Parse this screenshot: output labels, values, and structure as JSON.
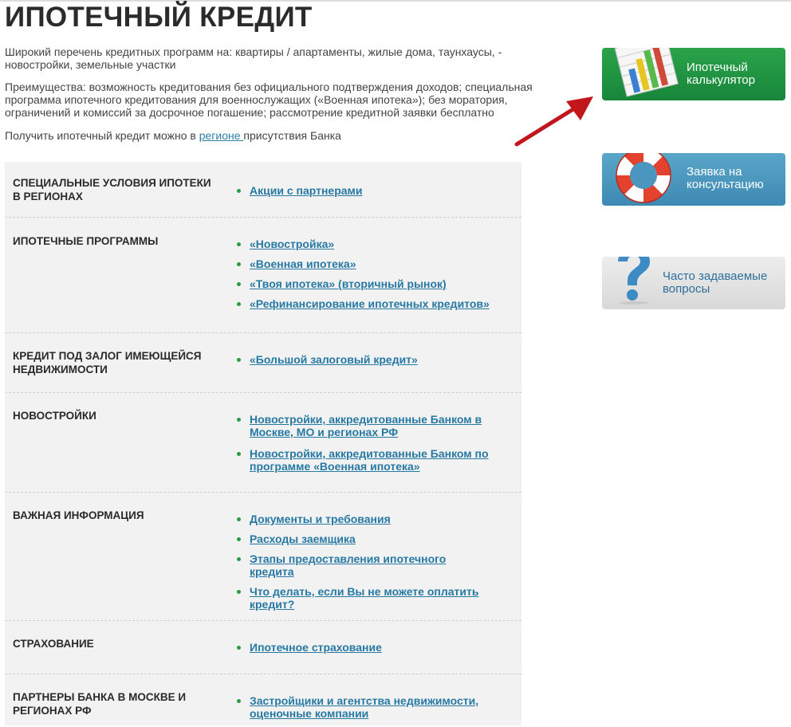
{
  "page": {
    "title": "ИПОТЕЧНЫЙ КРЕДИТ",
    "intro_1": "Широкий перечень кредитных программ на: квартиры / апартаменты, жилые дома,  таунхаусы, - новостройки,  земельные участки",
    "intro_2": "Преимущества: возможность кредитования без официального подтверждения доходов; специальная программа ипотечного кредитования для военнослужащих («Военная ипотека»); без моратория, ограничений и комиссий за досрочное погашение; рассмотрение кредитной заявки бесплатно",
    "intro_3_before": "Получить ипотечный кредит можно в ",
    "intro_3_link": "регионе ",
    "intro_3_after": "присутствия Банка"
  },
  "sections": [
    {
      "title": "СПЕЦИАЛЬНЫЕ УСЛОВИЯ ИПОТЕКИ В РЕГИОНАХ",
      "links": [
        "Акции с партнерами"
      ]
    },
    {
      "title": "ИПОТЕЧНЫЕ ПРОГРАММЫ",
      "links": [
        "«Новостройка»",
        "«Военная ипотека»",
        "«Твоя ипотека» (вторичный рынок)",
        "«Рефинансирование ипотечных кредитов»"
      ]
    },
    {
      "title": "КРЕДИТ ПОД ЗАЛОГ ИМЕЮЩЕЙСЯ НЕДВИЖИМОСТИ",
      "links": [
        "«Большой залоговый кредит»"
      ]
    },
    {
      "title": "НОВОСТРОЙКИ",
      "links": [
        "Новостройки, аккредитованные Банком в Москве, МО и регионах РФ ",
        "Новостройки, аккредитованные Банком по программе «Военная ипотека»"
      ]
    },
    {
      "title": "ВАЖНАЯ ИНФОРМАЦИЯ",
      "links": [
        "Документы и требования",
        "Расходы заемщика",
        "Этапы предоставления ипотечного кредита",
        "Что делать, если Вы не можете оплатить кредит?"
      ]
    },
    {
      "title": "СТРАХОВАНИЕ",
      "links": [
        "Ипотечное страхование"
      ]
    },
    {
      "title": "ПАРТНЕРЫ БАНКА В МОСКВЕ И РЕГИОНАХ РФ",
      "links": [
        "Застройщики и агентства недвижимости, оценочные компании"
      ]
    }
  ],
  "sidebar": {
    "calc_label": "Ипотечный калькулятор",
    "consult_label": "Заявка на консультацию",
    "faq_label": "Часто задаваемые вопросы"
  },
  "icons": {
    "calculator": "calculator-chart-icon",
    "consult": "lifebuoy-icon",
    "faq": "question-mark-icon",
    "arrow": "red-arrow-icon"
  },
  "colors": {
    "link": "#2779a3",
    "bullet": "#2b9a47",
    "calc_button": "#1f9443",
    "consult_button": "#4a96bf",
    "faq_button": "#e3e3e3",
    "arrow": "#c2161d"
  }
}
